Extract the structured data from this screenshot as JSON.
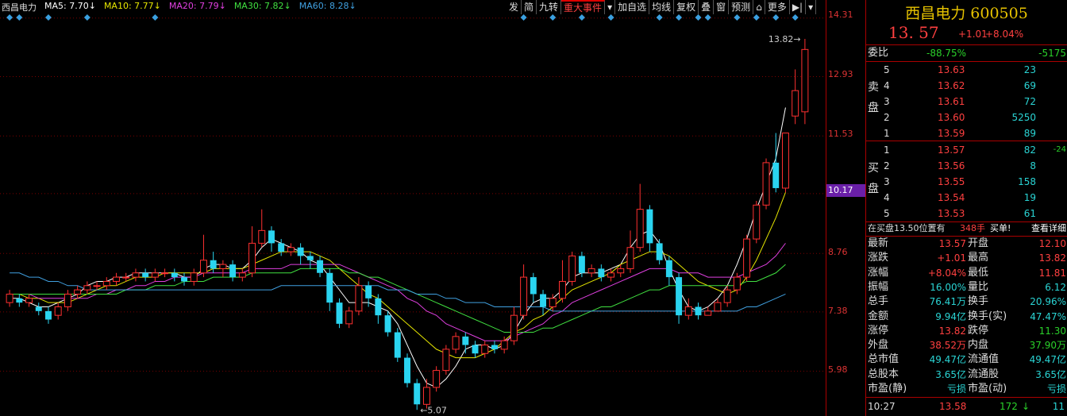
{
  "stock": {
    "name": "西昌电力",
    "code": "600505",
    "price": "13. 57",
    "change": "+1.01",
    "change_pct": "+8.04%"
  },
  "legend": {
    "name": "西昌电力",
    "ma5": "MA5: 7.70↓",
    "ma10": "MA10: 7.77↓",
    "ma20": "MA20: 7.79↓",
    "ma30": "MA30: 7.82↓",
    "ma60": "MA60: 8.28↓",
    "colors": {
      "ma5": "#ffffff",
      "ma10": "#e6e600",
      "ma20": "#e040e0",
      "ma30": "#40e040",
      "ma60": "#40a0e0"
    }
  },
  "toolbar": [
    "发",
    "简",
    "九转",
    "重大事件",
    "▾",
    "加自选",
    "均线",
    "复权",
    "叠",
    "窗",
    "预测",
    "⌂",
    "更多",
    "▶|",
    "▾"
  ],
  "axis": {
    "ticks": [
      "14.31",
      "12.93",
      "11.53",
      "10.17",
      "8.76",
      "7.38",
      "5.98"
    ],
    "current": "10.17"
  },
  "annotations": {
    "high": "13.82",
    "low": "5.07"
  },
  "orderbook": {
    "webi_label": "委比",
    "webi_pct": "-88.75%",
    "webi_diff": "-5175",
    "sell_label": [
      "卖",
      "盘"
    ],
    "buy_label": [
      "买",
      "盘"
    ],
    "sell": [
      {
        "lvl": "5",
        "price": "13.63",
        "vol": "23"
      },
      {
        "lvl": "4",
        "price": "13.62",
        "vol": "69"
      },
      {
        "lvl": "3",
        "price": "13.61",
        "vol": "72"
      },
      {
        "lvl": "2",
        "price": "13.60",
        "vol": "5250"
      },
      {
        "lvl": "1",
        "price": "13.59",
        "vol": "89"
      }
    ],
    "buy": [
      {
        "lvl": "1",
        "price": "13.57",
        "vol": "82",
        "delta": "-24"
      },
      {
        "lvl": "2",
        "price": "13.56",
        "vol": "8"
      },
      {
        "lvl": "3",
        "price": "13.55",
        "vol": "158"
      },
      {
        "lvl": "4",
        "price": "13.54",
        "vol": "19"
      },
      {
        "lvl": "5",
        "price": "13.53",
        "vol": "61"
      }
    ],
    "notice_text": "在买盘13.50位置有",
    "notice_vol": "348手",
    "notice_action": "买单!",
    "notice_link": "查看详细"
  },
  "stats": [
    {
      "l1": "最新",
      "v1": "13.57",
      "l2": "开盘",
      "v2": "12.10"
    },
    {
      "l1": "涨跌",
      "v1": "+1.01",
      "l2": "最高",
      "v2": "13.82"
    },
    {
      "l1": "涨幅",
      "v1": "+8.04%",
      "l2": "最低",
      "v2": "11.81"
    },
    {
      "l1": "振幅",
      "v1": "16.00%",
      "l2": "量比",
      "v2": "6.12"
    },
    {
      "l1": "总手",
      "v1": "76.41万",
      "l2": "换手",
      "v2": "20.96%"
    },
    {
      "l1": "金额",
      "v1": "9.94亿",
      "l2": "换手(实)",
      "v2": "47.47%"
    },
    {
      "l1": "涨停",
      "v1": "13.82",
      "l2": "跌停",
      "v2": "11.30"
    },
    {
      "l1": "外盘",
      "v1": "38.52万",
      "l2": "内盘",
      "v2": "37.90万"
    },
    {
      "l1": "总市值",
      "v1": "49.47亿",
      "l2": "流通值",
      "v2": "49.47亿"
    },
    {
      "l1": "总股本",
      "v1": "3.65亿",
      "l2": "流通股",
      "v2": "3.65亿"
    },
    {
      "l1": "市盈(静)",
      "v1": "亏损",
      "l2": "市盈(动)",
      "v2": "亏损"
    }
  ],
  "tick": {
    "time": "10:27",
    "price": "13.58",
    "vol": "172",
    "arrow": "↓",
    "count": "11"
  },
  "chart_data": {
    "type": "candlestick",
    "ylim": [
      5.0,
      14.4
    ],
    "candles": [
      {
        "o": 7.6,
        "c": 7.8,
        "h": 7.9,
        "l": 7.5
      },
      {
        "o": 7.7,
        "c": 7.6,
        "h": 7.8,
        "l": 7.5
      },
      {
        "o": 7.6,
        "c": 7.7,
        "h": 7.8,
        "l": 7.5
      },
      {
        "o": 7.5,
        "c": 7.4,
        "h": 7.6,
        "l": 7.3
      },
      {
        "o": 7.4,
        "c": 7.2,
        "h": 7.5,
        "l": 7.1
      },
      {
        "o": 7.3,
        "c": 7.5,
        "h": 7.6,
        "l": 7.2
      },
      {
        "o": 7.5,
        "c": 7.8,
        "h": 7.9,
        "l": 7.4
      },
      {
        "o": 7.8,
        "c": 7.9,
        "h": 8.0,
        "l": 7.7
      },
      {
        "o": 7.9,
        "c": 8.0,
        "h": 8.1,
        "l": 7.8
      },
      {
        "o": 8.0,
        "c": 8.0,
        "h": 8.1,
        "l": 7.9
      },
      {
        "o": 8.0,
        "c": 8.1,
        "h": 8.2,
        "l": 7.9
      },
      {
        "o": 8.1,
        "c": 8.2,
        "h": 8.3,
        "l": 8.0
      },
      {
        "o": 8.2,
        "c": 8.2,
        "h": 8.3,
        "l": 8.1
      },
      {
        "o": 8.2,
        "c": 8.3,
        "h": 8.4,
        "l": 8.1
      },
      {
        "o": 8.3,
        "c": 8.2,
        "h": 8.4,
        "l": 8.1
      },
      {
        "o": 8.2,
        "c": 8.3,
        "h": 8.4,
        "l": 8.1
      },
      {
        "o": 8.3,
        "c": 8.3,
        "h": 8.4,
        "l": 8.2
      },
      {
        "o": 8.3,
        "c": 8.2,
        "h": 8.4,
        "l": 8.1
      },
      {
        "o": 8.2,
        "c": 8.1,
        "h": 8.3,
        "l": 8.0
      },
      {
        "o": 8.1,
        "c": 8.3,
        "h": 8.4,
        "l": 8.0
      },
      {
        "o": 8.3,
        "c": 8.6,
        "h": 9.2,
        "l": 8.2
      },
      {
        "o": 8.6,
        "c": 8.4,
        "h": 8.8,
        "l": 8.3
      },
      {
        "o": 8.4,
        "c": 8.5,
        "h": 8.6,
        "l": 8.2
      },
      {
        "o": 8.5,
        "c": 8.2,
        "h": 8.6,
        "l": 8.1
      },
      {
        "o": 8.2,
        "c": 8.3,
        "h": 8.4,
        "l": 8.1
      },
      {
        "o": 8.3,
        "c": 9.0,
        "h": 9.4,
        "l": 8.2
      },
      {
        "o": 9.0,
        "c": 9.3,
        "h": 9.8,
        "l": 8.9
      },
      {
        "o": 9.3,
        "c": 9.0,
        "h": 9.4,
        "l": 8.8
      },
      {
        "o": 9.0,
        "c": 8.8,
        "h": 9.1,
        "l": 8.7
      },
      {
        "o": 8.8,
        "c": 8.9,
        "h": 9.0,
        "l": 8.7
      },
      {
        "o": 8.9,
        "c": 8.7,
        "h": 9.0,
        "l": 8.5
      },
      {
        "o": 8.7,
        "c": 8.6,
        "h": 8.8,
        "l": 8.4
      },
      {
        "o": 8.6,
        "c": 8.3,
        "h": 8.7,
        "l": 8.2
      },
      {
        "o": 8.3,
        "c": 7.6,
        "h": 8.4,
        "l": 7.4
      },
      {
        "o": 7.6,
        "c": 7.1,
        "h": 7.7,
        "l": 7.0
      },
      {
        "o": 7.1,
        "c": 7.4,
        "h": 7.5,
        "l": 7.0
      },
      {
        "o": 7.4,
        "c": 8.0,
        "h": 8.2,
        "l": 7.3
      },
      {
        "o": 8.0,
        "c": 7.7,
        "h": 8.1,
        "l": 7.5
      },
      {
        "o": 7.7,
        "c": 7.3,
        "h": 7.8,
        "l": 7.1
      },
      {
        "o": 7.3,
        "c": 6.9,
        "h": 7.4,
        "l": 6.8
      },
      {
        "o": 6.9,
        "c": 6.3,
        "h": 7.0,
        "l": 6.2
      },
      {
        "o": 6.3,
        "c": 5.7,
        "h": 6.4,
        "l": 5.6
      },
      {
        "o": 5.7,
        "c": 5.2,
        "h": 5.8,
        "l": 5.07
      },
      {
        "o": 5.2,
        "c": 5.6,
        "h": 5.8,
        "l": 5.1
      },
      {
        "o": 5.6,
        "c": 6.0,
        "h": 6.1,
        "l": 5.5
      },
      {
        "o": 6.0,
        "c": 6.5,
        "h": 6.6,
        "l": 5.9
      },
      {
        "o": 6.5,
        "c": 6.8,
        "h": 6.9,
        "l": 6.4
      },
      {
        "o": 6.8,
        "c": 6.6,
        "h": 6.9,
        "l": 6.4
      },
      {
        "o": 6.6,
        "c": 6.4,
        "h": 6.7,
        "l": 6.3
      },
      {
        "o": 6.4,
        "c": 6.6,
        "h": 6.7,
        "l": 6.3
      },
      {
        "o": 6.6,
        "c": 6.5,
        "h": 6.7,
        "l": 6.4
      },
      {
        "o": 6.5,
        "c": 6.7,
        "h": 6.8,
        "l": 6.4
      },
      {
        "o": 6.7,
        "c": 7.3,
        "h": 7.5,
        "l": 6.6
      },
      {
        "o": 7.3,
        "c": 8.2,
        "h": 8.5,
        "l": 7.2
      },
      {
        "o": 8.2,
        "c": 7.8,
        "h": 8.3,
        "l": 7.6
      },
      {
        "o": 7.8,
        "c": 7.5,
        "h": 7.9,
        "l": 7.3
      },
      {
        "o": 7.5,
        "c": 7.7,
        "h": 7.8,
        "l": 7.4
      },
      {
        "o": 7.7,
        "c": 8.1,
        "h": 8.6,
        "l": 7.6
      },
      {
        "o": 8.1,
        "c": 8.7,
        "h": 8.8,
        "l": 8.0
      },
      {
        "o": 8.7,
        "c": 8.3,
        "h": 8.8,
        "l": 8.2
      },
      {
        "o": 8.3,
        "c": 8.4,
        "h": 8.5,
        "l": 8.2
      },
      {
        "o": 8.4,
        "c": 8.2,
        "h": 8.5,
        "l": 8.1
      },
      {
        "o": 8.2,
        "c": 8.3,
        "h": 8.4,
        "l": 8.1
      },
      {
        "o": 8.3,
        "c": 8.4,
        "h": 8.5,
        "l": 8.2
      },
      {
        "o": 8.4,
        "c": 8.9,
        "h": 9.3,
        "l": 8.3
      },
      {
        "o": 8.9,
        "c": 9.8,
        "h": 10.4,
        "l": 8.8
      },
      {
        "o": 9.8,
        "c": 9.0,
        "h": 9.9,
        "l": 8.8
      },
      {
        "o": 9.0,
        "c": 8.6,
        "h": 9.1,
        "l": 8.5
      },
      {
        "o": 8.6,
        "c": 8.2,
        "h": 8.7,
        "l": 8.0
      },
      {
        "o": 8.2,
        "c": 7.3,
        "h": 8.3,
        "l": 7.1
      },
      {
        "o": 7.3,
        "c": 7.5,
        "h": 7.7,
        "l": 7.2
      },
      {
        "o": 7.5,
        "c": 7.3,
        "h": 7.6,
        "l": 7.2
      },
      {
        "o": 7.3,
        "c": 7.4,
        "h": 7.5,
        "l": 7.3
      },
      {
        "o": 7.4,
        "c": 7.6,
        "h": 7.7,
        "l": 7.4
      },
      {
        "o": 7.6,
        "c": 7.9,
        "h": 8.0,
        "l": 7.5
      },
      {
        "o": 7.9,
        "c": 8.2,
        "h": 8.3,
        "l": 7.8
      },
      {
        "o": 8.2,
        "c": 9.1,
        "h": 9.2,
        "l": 8.1
      },
      {
        "o": 9.1,
        "c": 9.9,
        "h": 10.0,
        "l": 9.0
      },
      {
        "o": 9.9,
        "c": 10.9,
        "h": 11.0,
        "l": 9.8
      },
      {
        "o": 10.9,
        "c": 10.3,
        "h": 11.6,
        "l": 10.2
      },
      {
        "o": 10.3,
        "c": 11.6,
        "h": 11.6,
        "l": 10.2
      },
      {
        "o": 12.0,
        "c": 12.6,
        "h": 13.1,
        "l": 11.81
      },
      {
        "o": 12.1,
        "c": 13.57,
        "h": 13.82,
        "l": 11.81
      }
    ],
    "ma_lines": [
      {
        "name": "MA5",
        "points": [
          7.7,
          7.7,
          7.6,
          7.5,
          7.5,
          7.6,
          7.7,
          7.8,
          8.0,
          8.1,
          8.1,
          8.2,
          8.2,
          8.3,
          8.3,
          8.3,
          8.3,
          8.3,
          8.2,
          8.2,
          8.4,
          8.5,
          8.5,
          8.4,
          8.4,
          8.6,
          8.9,
          9.1,
          9.0,
          8.9,
          8.8,
          8.6,
          8.5,
          8.2,
          7.9,
          7.6,
          7.6,
          7.6,
          7.5,
          7.4,
          7.1,
          6.6,
          6.1,
          5.7,
          5.6,
          5.8,
          6.1,
          6.5,
          6.6,
          6.6,
          6.5,
          6.6,
          6.9,
          7.3,
          7.6,
          7.7,
          7.7,
          7.9,
          8.2,
          8.3,
          8.3,
          8.3,
          8.4,
          8.5,
          8.9,
          9.2,
          9.3,
          9.0,
          8.4,
          7.9,
          7.5,
          7.4,
          7.5,
          7.7,
          8.0,
          8.5,
          9.1,
          9.8,
          10.4,
          11.0,
          12.2
        ]
      },
      {
        "name": "MA10",
        "points": [
          7.8,
          7.8,
          7.7,
          7.7,
          7.6,
          7.6,
          7.6,
          7.7,
          7.8,
          7.9,
          8.0,
          8.0,
          8.1,
          8.2,
          8.2,
          8.2,
          8.3,
          8.3,
          8.3,
          8.3,
          8.3,
          8.4,
          8.4,
          8.4,
          8.4,
          8.5,
          8.6,
          8.7,
          8.8,
          8.8,
          8.8,
          8.8,
          8.7,
          8.6,
          8.4,
          8.2,
          8.0,
          7.8,
          7.7,
          7.5,
          7.3,
          7.1,
          6.9,
          6.7,
          6.5,
          6.4,
          6.3,
          6.3,
          6.3,
          6.4,
          6.5,
          6.7,
          6.9,
          7.0,
          7.2,
          7.3,
          7.5,
          7.7,
          7.9,
          8.0,
          8.1,
          8.2,
          8.3,
          8.5,
          8.6,
          8.7,
          8.8,
          8.8,
          8.7,
          8.5,
          8.3,
          8.1,
          8.0,
          7.9,
          7.8,
          7.9,
          8.2,
          8.6,
          9.1,
          9.6,
          10.2
        ]
      },
      {
        "name": "MA20",
        "points": [
          7.8,
          7.8,
          7.8,
          7.7,
          7.7,
          7.7,
          7.7,
          7.7,
          7.7,
          7.8,
          7.8,
          7.9,
          7.9,
          8.0,
          8.0,
          8.1,
          8.1,
          8.2,
          8.2,
          8.2,
          8.3,
          8.3,
          8.3,
          8.3,
          8.3,
          8.4,
          8.4,
          8.4,
          8.4,
          8.5,
          8.5,
          8.5,
          8.5,
          8.5,
          8.5,
          8.4,
          8.3,
          8.2,
          8.1,
          8.0,
          7.9,
          7.7,
          7.6,
          7.4,
          7.3,
          7.1,
          7.0,
          6.9,
          6.8,
          6.7,
          6.7,
          6.7,
          6.8,
          6.9,
          7.0,
          7.1,
          7.3,
          7.4,
          7.6,
          7.7,
          7.8,
          7.9,
          8.0,
          8.1,
          8.2,
          8.3,
          8.4,
          8.4,
          8.4,
          8.3,
          8.3,
          8.3,
          8.2,
          8.2,
          8.2,
          8.2,
          8.3,
          8.4,
          8.5,
          8.7,
          9.0
        ]
      },
      {
        "name": "MA30",
        "points": [
          7.8,
          7.8,
          7.8,
          7.8,
          7.8,
          7.8,
          7.8,
          7.8,
          7.8,
          7.8,
          7.8,
          7.8,
          7.9,
          7.9,
          7.9,
          8.0,
          8.0,
          8.0,
          8.1,
          8.1,
          8.1,
          8.2,
          8.2,
          8.2,
          8.2,
          8.3,
          8.3,
          8.3,
          8.3,
          8.3,
          8.4,
          8.4,
          8.4,
          8.4,
          8.4,
          8.3,
          8.3,
          8.2,
          8.2,
          8.1,
          8.0,
          7.9,
          7.8,
          7.7,
          7.6,
          7.5,
          7.4,
          7.3,
          7.2,
          7.1,
          7.0,
          6.9,
          6.9,
          6.9,
          6.9,
          7.0,
          7.0,
          7.1,
          7.2,
          7.3,
          7.4,
          7.5,
          7.5,
          7.6,
          7.7,
          7.8,
          7.9,
          7.9,
          8.0,
          8.0,
          8.0,
          8.0,
          8.0,
          8.0,
          8.0,
          8.0,
          8.1,
          8.1,
          8.2,
          8.3,
          8.5
        ]
      },
      {
        "name": "MA60",
        "points": [
          8.3,
          8.3,
          8.2,
          8.2,
          8.1,
          8.1,
          8.0,
          8.0,
          7.9,
          7.9,
          7.9,
          7.9,
          7.9,
          7.9,
          7.9,
          7.9,
          7.9,
          7.9,
          7.9,
          7.9,
          7.9,
          7.9,
          7.9,
          7.9,
          7.9,
          7.9,
          7.9,
          7.9,
          8.0,
          8.0,
          8.0,
          8.0,
          8.0,
          8.0,
          8.0,
          8.0,
          8.0,
          8.0,
          8.0,
          7.9,
          7.9,
          7.9,
          7.8,
          7.8,
          7.8,
          7.7,
          7.7,
          7.6,
          7.6,
          7.6,
          7.5,
          7.5,
          7.5,
          7.5,
          7.5,
          7.5,
          7.4,
          7.4,
          7.4,
          7.4,
          7.4,
          7.4,
          7.4,
          7.4,
          7.4,
          7.4,
          7.4,
          7.4,
          7.4,
          7.4,
          7.4,
          7.4,
          7.4,
          7.4,
          7.4,
          7.4,
          7.5,
          7.5,
          7.6,
          7.7,
          7.8
        ]
      }
    ],
    "event_markers": [
      0,
      1,
      4,
      8,
      15,
      53,
      56,
      59,
      62,
      67,
      69,
      71,
      72,
      75,
      77,
      79,
      81
    ]
  }
}
